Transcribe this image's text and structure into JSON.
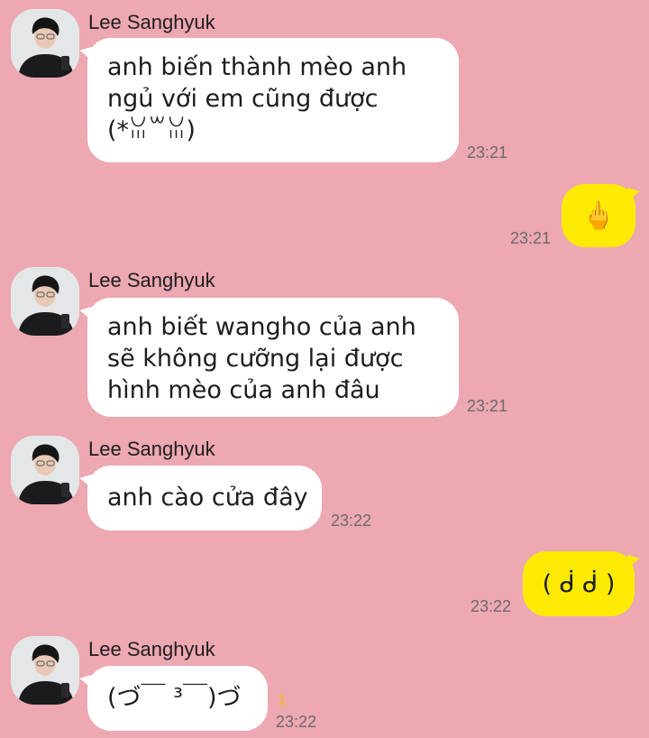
{
  "messages": [
    {
      "sender": "Lee Sanghyuk",
      "lines": [
        "anh biến thành mèo anh",
        "ngủ với em cũng được",
        "(*ꈍ꒳ꈍ)"
      ],
      "time": "23:21"
    },
    {
      "outgoing_emoji": "🖕",
      "time": "23:21"
    },
    {
      "sender": "Lee Sanghyuk",
      "lines": [
        "anh biết wangho của anh",
        "sẽ không cưỡng lại được",
        "hình mèo của anh đâu"
      ],
      "time": "23:21"
    },
    {
      "sender": "Lee Sanghyuk",
      "lines": [
        "anh cào cửa đây"
      ],
      "time": "23:22"
    },
    {
      "outgoing_text": "( ᑰ ᑰ )",
      "time": "23:22"
    },
    {
      "sender": "Lee Sanghyuk",
      "lines": [
        "(づ￣ ³￣)づ"
      ],
      "unread": "1",
      "time": "23:22"
    }
  ],
  "colors": {
    "background": "#eda8b2",
    "incoming_bubble": "#ffffff",
    "outgoing_bubble": "#fdea03",
    "unread": "#f2c200"
  }
}
